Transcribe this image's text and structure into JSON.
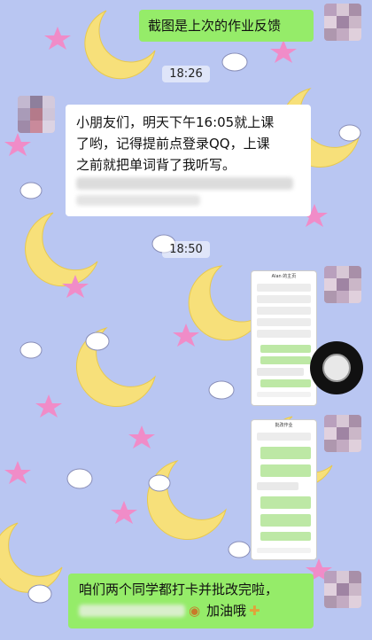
{
  "chat": {
    "messages": [
      {
        "from": "me",
        "text": "截图是上次的作业反馈"
      },
      {
        "from": "them",
        "line1": "小朋友们，明天下午16:05就上课",
        "line2": "了哟，记得提前点登录QQ，上课",
        "line3": "之前就把单词背了我听写。"
      },
      {
        "from": "me",
        "line1": "咱们两个同学都打卡并批改完啦，",
        "line2": "加油哦"
      }
    ],
    "timestamps": [
      "18:26",
      "18:50"
    ]
  },
  "screenshots": {
    "first_title": "Alan 的主页",
    "second_title": "批改作业"
  },
  "icons": {
    "emoji_snail": "snail-emoji",
    "emoji_muscle": "flexed-biceps-emoji"
  },
  "colors": {
    "background": "#b9c6f2",
    "sent_bubble": "#95ec69",
    "received_bubble": "#ffffff",
    "moon": "#f7e07a",
    "star": "#f08cc8"
  }
}
